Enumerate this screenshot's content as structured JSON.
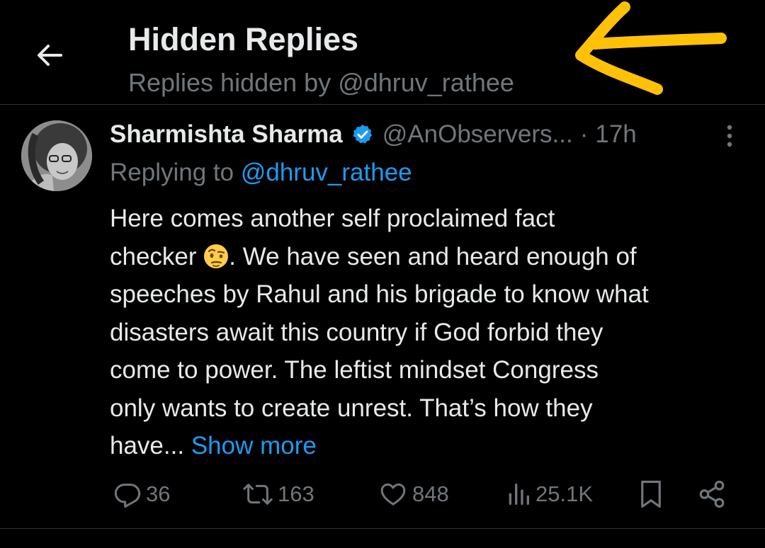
{
  "header": {
    "title": "Hidden Replies",
    "subtitle": "Replies hidden by @dhruv_rathee"
  },
  "tweet": {
    "author": {
      "display_name": "Sharmishta Sharma",
      "handle": "@AnObservers...",
      "verified": true
    },
    "separator": "·",
    "time": "17h",
    "replying_to_prefix": "Replying to",
    "replying_to_handle": "@dhruv_rathee",
    "text_lines": [
      "Here comes another self proclaimed fact",
      "checker",
      ".  We have seen and heard enough of",
      "speeches by Rahul and his brigade to know what",
      "disasters await this country if God forbid they",
      "come to power. The leftist mindset Congress",
      "only wants to create unrest. That’s how they",
      "have..."
    ],
    "emoji": "face-with-raised-eyebrow",
    "show_more": "Show more",
    "stats": {
      "replies": "36",
      "retweets": "163",
      "likes": "848",
      "views": "25.1K"
    }
  },
  "icons": {
    "back": "arrow-left-icon",
    "verified": "verified-badge-icon",
    "more": "more-vertical-icon",
    "reply": "reply-icon",
    "retweet": "retweet-icon",
    "like": "heart-icon",
    "views": "views-icon",
    "bookmark": "bookmark-icon",
    "share": "share-icon"
  },
  "colors": {
    "background": "#000000",
    "text_primary": "#e7e9ea",
    "text_secondary": "#71767b",
    "accent": "#1d9bf0",
    "annotation": "#ffc107",
    "divider": "#2f3336"
  }
}
